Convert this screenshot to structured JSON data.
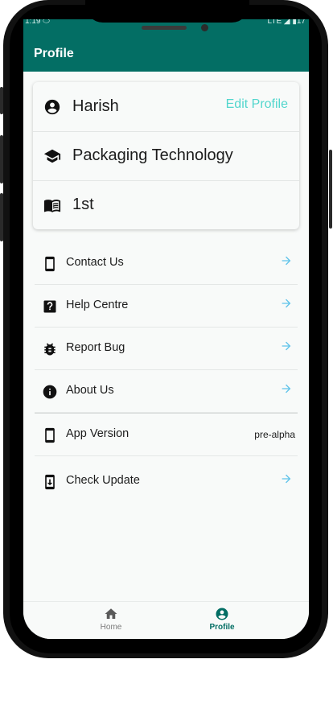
{
  "status_bar": {
    "time": "1:19 ⬭",
    "icons": "LTE ◢ ▮17"
  },
  "app_bar": {
    "title": "Profile"
  },
  "profile_card": {
    "name": "Harish",
    "edit_label": "Edit Profile",
    "course": "Packaging Technology",
    "year": "1st",
    "accent": "#52d6cd"
  },
  "menu": [
    {
      "label": "Contact Us",
      "icon": "smartphone-icon",
      "action": "arrow"
    },
    {
      "label": "Help Centre",
      "icon": "help-icon",
      "action": "arrow"
    },
    {
      "label": "Report Bug",
      "icon": "bug-icon",
      "action": "arrow"
    },
    {
      "label": "About Us",
      "icon": "info-icon",
      "action": "arrow"
    },
    {
      "label": "App Version",
      "icon": "smartphone-icon",
      "value": "pre-alpha"
    },
    {
      "label": "Check Update",
      "icon": "system-update-icon",
      "action": "arrow"
    }
  ],
  "bottom_nav": {
    "items": [
      {
        "label": "Home",
        "icon": "home-icon",
        "active": false
      },
      {
        "label": "Profile",
        "icon": "account-icon",
        "active": true
      }
    ]
  },
  "colors": {
    "primary": "#036e64",
    "arrow": "#5fc3ea"
  }
}
